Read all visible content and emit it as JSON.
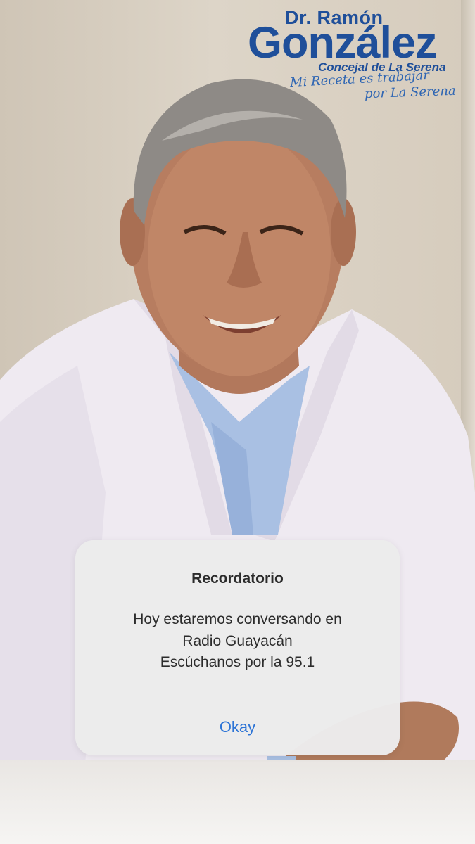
{
  "logo": {
    "prefix": "Dr. Ramón",
    "name": "González",
    "subtitle": "Concejal de La Serena",
    "slogan_line1": "Mi Receta es trabajar",
    "slogan_line2": "por La Serena"
  },
  "dialog": {
    "title": "Recordatorio",
    "message_lines": [
      "Hoy estaremos conversando en",
      "Radio Guayacán",
      "Escúchanos por la 95.1"
    ],
    "button_label": "Okay"
  },
  "colors": {
    "brand_blue": "#1f4f9a",
    "button_blue": "#2d74d6",
    "dialog_bg": "#ececec"
  }
}
